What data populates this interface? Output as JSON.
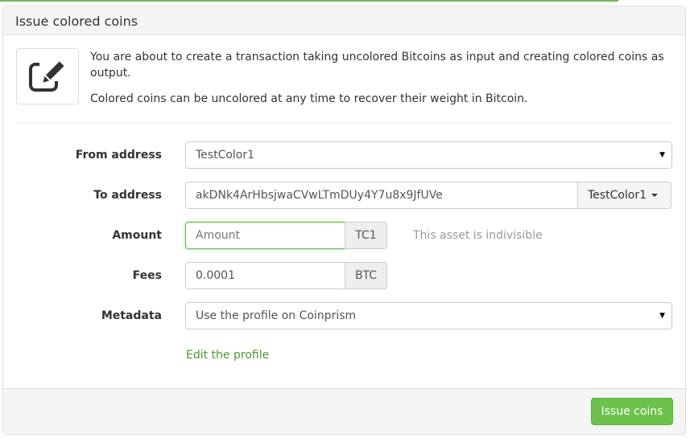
{
  "panel": {
    "title": "Issue colored coins"
  },
  "intro": {
    "icon": "edit-icon",
    "line1": "You are about to create a transaction taking uncolored Bitcoins as input and creating colored coins as output.",
    "line2": "Colored coins can be uncolored at any time to recover their weight in Bitcoin."
  },
  "form": {
    "from": {
      "label": "From address",
      "value": "TestColor1"
    },
    "to": {
      "label": "To address",
      "value": "akDNk4ArHbsjwaCVwLTmDUy4Y7u8x9JfUVe",
      "dropdown": "TestColor1"
    },
    "amount": {
      "label": "Amount",
      "placeholder": "Amount",
      "unit": "TC1",
      "help": "This asset is indivisible"
    },
    "fees": {
      "label": "Fees",
      "value": "0.0001",
      "unit": "BTC"
    },
    "metadata": {
      "label": "Metadata",
      "value": "Use the profile on Coinprism",
      "link": "Edit the profile"
    }
  },
  "footer": {
    "submit": "Issue coins"
  },
  "colors": {
    "accent": "#6cc24a",
    "link": "#4a9a2a",
    "focus": "#66bb44"
  }
}
